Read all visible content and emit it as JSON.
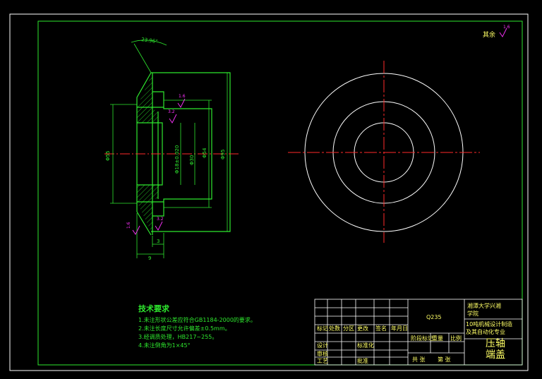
{
  "roughness_default": "其余",
  "roughness_values": {
    "default": "1.6",
    "bore_face": "1.6",
    "bore": "3.2",
    "left_bottom": "1.6",
    "right_bottom": "3.2"
  },
  "dimensions": {
    "angle": "23.96°",
    "outer_dia": "Φ95",
    "left_dia": "Φ55",
    "shoulder_dia": "Φ54",
    "bore_dia": "Φ18±0.020",
    "inner_dia": "Φ30",
    "width": "9",
    "groove": "3"
  },
  "tech_requirements": {
    "title": "技术要求",
    "items": [
      "1.未注形状公差应符合GB1184-2000的要求。",
      "2.未注长度尺寸允许偏差±0.5mm。",
      "3.经调质处理，HB217~255。",
      "4.未注倒角为1×45°"
    ]
  },
  "title_block": {
    "material": "Q235",
    "school_line1": "湘潭大学兴湘",
    "school_line2": "学院",
    "project_line1": "10吨机械设计制造",
    "project_line2": "及其自动化专业",
    "part_name_line1": "压轴",
    "part_name_line2": "端盖",
    "row_labels": [
      "标记",
      "处数",
      "分区",
      "更改",
      "签名",
      "年月日"
    ],
    "designer": "设计",
    "standardize": "标准化",
    "stage": "阶段标记",
    "weight": "重量",
    "scale": "比例",
    "check": "审核",
    "process": "工艺",
    "approve": "批准",
    "sheet_total": "共 张",
    "sheet_no": "第 张"
  },
  "colors": {
    "background": "#000000",
    "frame": "#ffffff",
    "outline": "#2ee82e",
    "centerline": "#ff2a2a",
    "hatch": "#2ee82e",
    "dimension": "#2ee82e",
    "roughness": "#ff33ff",
    "titleblock_text": "#ffff66"
  }
}
